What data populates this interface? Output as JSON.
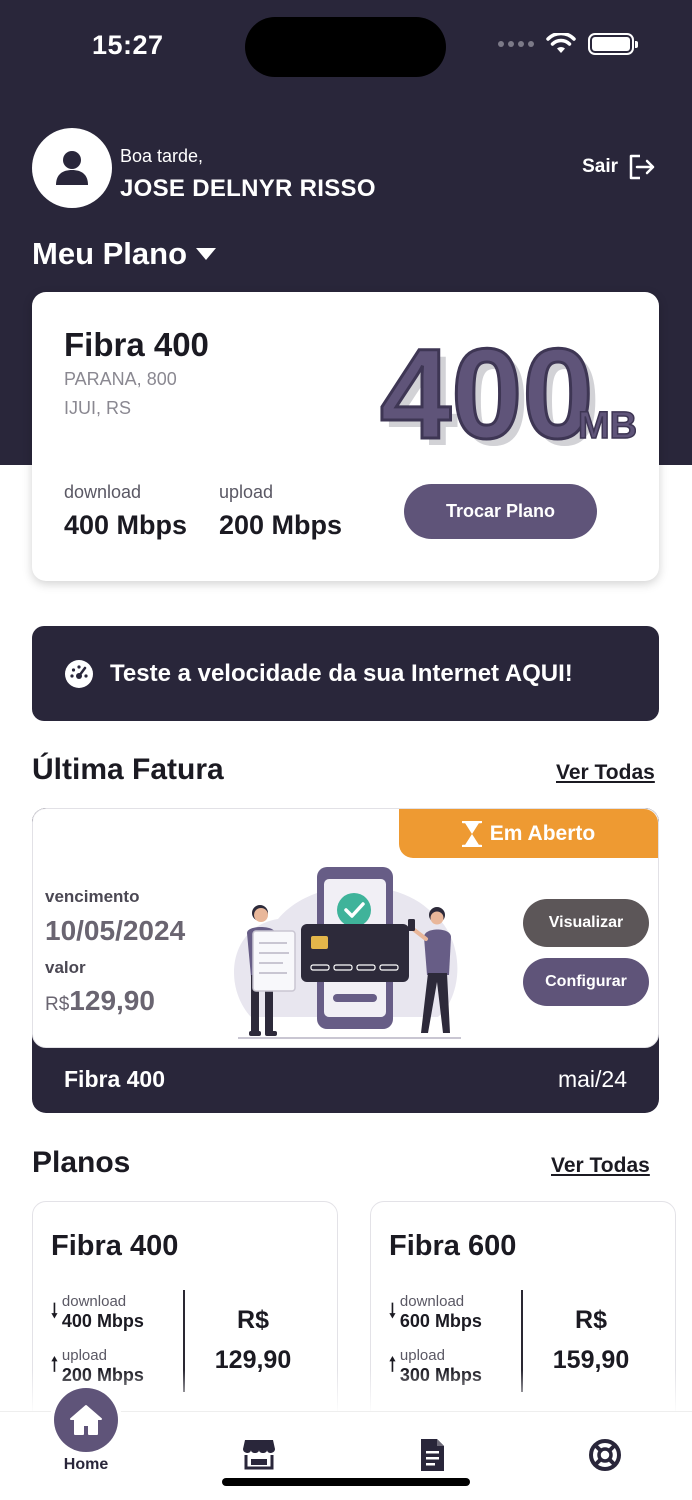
{
  "status_bar": {
    "time": "15:27"
  },
  "header": {
    "greeting": "Boa tarde,",
    "user_name": "JOSE DELNYR RISSO",
    "logout_label": "Sair",
    "section_title": "Meu Plano"
  },
  "plan": {
    "name": "Fibra 400",
    "address_line1": "PARANA, 800",
    "address_line2": "IJUI, RS",
    "badge_number": "400",
    "badge_unit": "MB",
    "download_label": "download",
    "download_value": "400 Mbps",
    "upload_label": "upload",
    "upload_value": "200 Mbps",
    "change_button": "Trocar Plano"
  },
  "speed_test": {
    "label": "Teste a velocidade da sua Internet AQUI!"
  },
  "invoice": {
    "section_title": "Última Fatura",
    "see_all": "Ver Todas",
    "status": "Em Aberto",
    "due_label": "vencimento",
    "due_date": "10/05/2024",
    "amount_label": "valor",
    "currency": "R$",
    "amount": "129,90",
    "view_button": "Visualizar",
    "configure_button": "Configurar",
    "plan_name": "Fibra 400",
    "month": "mai/24"
  },
  "plans": {
    "section_title": "Planos",
    "see_all": "Ver Todas",
    "items": [
      {
        "name": "Fibra 400",
        "download_label": "download",
        "download_value": "400 Mbps",
        "upload_label": "upload",
        "upload_value": "200 Mbps",
        "currency": "R$",
        "price": "129,90"
      },
      {
        "name": "Fibra 600",
        "download_label": "download",
        "download_value": "600 Mbps",
        "upload_label": "upload",
        "upload_value": "300 Mbps",
        "currency": "R$",
        "price": "159,90"
      }
    ]
  },
  "nav": {
    "home_label": "Home",
    "items": [
      {
        "icon": "home-icon"
      },
      {
        "icon": "store-icon"
      },
      {
        "icon": "invoice-icon"
      },
      {
        "icon": "support-icon"
      }
    ]
  },
  "colors": {
    "header_bg": "#29263a",
    "accent": "#5f5479",
    "status_open": "#ee9a32"
  }
}
